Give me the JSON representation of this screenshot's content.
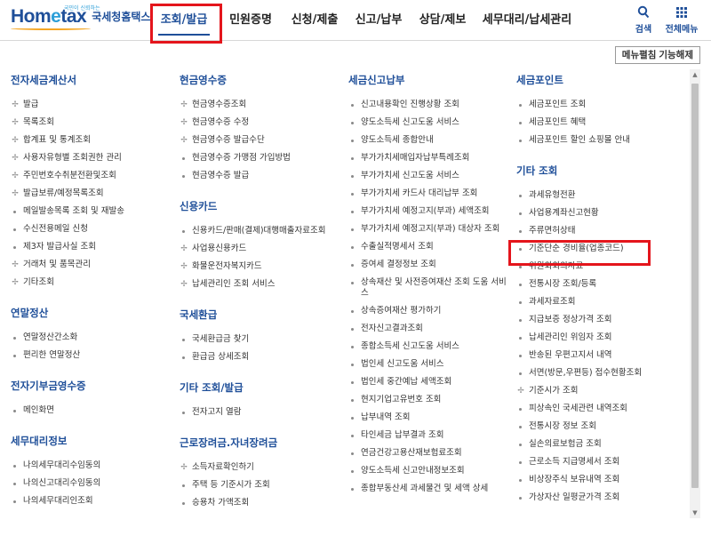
{
  "header": {
    "logo_main_a": "Hom",
    "logo_main_e": "e",
    "logo_main_b": "tax",
    "logo_tag": "국민이 신뢰하는",
    "logo_sub": "국세청홈택스",
    "nav": [
      "조회/발급",
      "민원증명",
      "신청/제출",
      "신고/납부",
      "상담/제보",
      "세무대리/납세관리"
    ],
    "search_label": "검색",
    "menu_label": "전체메뉴"
  },
  "toolbar": {
    "unfold_label": "메뉴펼침 기능해제"
  },
  "columns": [
    {
      "sections": [
        {
          "title": "전자세금계산서",
          "items": [
            {
              "t": "발급",
              "m": "plus"
            },
            {
              "t": "목록조회",
              "m": "plus"
            },
            {
              "t": "합계표 및 통계조회",
              "m": "plus"
            },
            {
              "t": "사용자유형별 조회권한 관리",
              "m": "plus"
            },
            {
              "t": "주민번호수취분전환및조회",
              "m": "plus"
            },
            {
              "t": "발급보류/예정목록조회",
              "m": "plus"
            },
            {
              "t": "메일발송목록 조회 및 재발송",
              "m": "dot"
            },
            {
              "t": "수신전용메일 신청",
              "m": "dot"
            },
            {
              "t": "제3자 발급사실 조회",
              "m": "dot"
            },
            {
              "t": "거래처 및 품목관리",
              "m": "plus"
            },
            {
              "t": "기타조회",
              "m": "plus"
            }
          ]
        },
        {
          "title": "연말정산",
          "items": [
            {
              "t": "연말정산간소화",
              "m": "dot"
            },
            {
              "t": "편리한 연말정산",
              "m": "dot"
            }
          ]
        },
        {
          "title": "전자기부금영수증",
          "items": [
            {
              "t": "메인화면",
              "m": "dot"
            }
          ]
        },
        {
          "title": "세무대리정보",
          "items": [
            {
              "t": "나의세무대리수임동의",
              "m": "dot"
            },
            {
              "t": "나의신고대리수임동의",
              "m": "dot"
            },
            {
              "t": "나의세무대리인조회",
              "m": "dot"
            }
          ]
        }
      ]
    },
    {
      "sections": [
        {
          "title": "현금영수증",
          "items": [
            {
              "t": "현금영수증조회",
              "m": "plus"
            },
            {
              "t": "현금영수증 수정",
              "m": "plus"
            },
            {
              "t": "현금영수증 발급수단",
              "m": "plus"
            },
            {
              "t": "현금영수증 가맹점 가입방법",
              "m": "dot"
            },
            {
              "t": "현금영수증 발급",
              "m": "dot"
            }
          ]
        },
        {
          "title": "신용카드",
          "items": [
            {
              "t": "신용카드/판매(결제)대행매출자료조회",
              "m": "dot"
            },
            {
              "t": "사업용신용카드",
              "m": "plus"
            },
            {
              "t": "화물운전자복지카드",
              "m": "plus"
            },
            {
              "t": "납세관리인 조회 서비스",
              "m": "plus"
            }
          ]
        },
        {
          "title": "국세환급",
          "items": [
            {
              "t": "국세환급금 찾기",
              "m": "dot"
            },
            {
              "t": "환급금 상세조회",
              "m": "dot"
            }
          ]
        },
        {
          "title": "기타 조회/발급",
          "items": [
            {
              "t": "전자고지 열람",
              "m": "dot"
            }
          ]
        },
        {
          "title": "근로장려금.자녀장려금",
          "items": [
            {
              "t": "소득자료확인하기",
              "m": "plus"
            },
            {
              "t": "주택 등 기준시가 조회",
              "m": "dot"
            },
            {
              "t": "승용차 가액조회",
              "m": "dot"
            }
          ]
        }
      ]
    },
    {
      "sections": [
        {
          "title": "세금신고납부",
          "items": [
            {
              "t": "신고내용확인 진행상황 조회",
              "m": "dot"
            },
            {
              "t": "양도소득세 신고도움 서비스",
              "m": "dot"
            },
            {
              "t": "양도소득세 종합안내",
              "m": "dot"
            },
            {
              "t": "부가가치세매입자납부특례조회",
              "m": "dot"
            },
            {
              "t": "부가가치세 신고도움 서비스",
              "m": "dot"
            },
            {
              "t": "부가가치세 카드사 대리납부 조회",
              "m": "dot"
            },
            {
              "t": "부가가치세 예정고지(부과) 세액조회",
              "m": "dot"
            },
            {
              "t": "부가가치세 예정고지(부과) 대상자 조회",
              "m": "dot",
              "wrap": true
            },
            {
              "t": "수출실적명세서 조회",
              "m": "dot"
            },
            {
              "t": "증여세 결정정보 조회",
              "m": "dot"
            },
            {
              "t": "상속재산 및 사전증여재산 조회 도움 서비스",
              "m": "dot",
              "wrap": true
            },
            {
              "t": "상속증여재산 평가하기",
              "m": "dot"
            },
            {
              "t": "전자신고결과조회",
              "m": "dot"
            },
            {
              "t": "종합소득세 신고도움 서비스",
              "m": "dot"
            },
            {
              "t": "법인세 신고도움 서비스",
              "m": "dot"
            },
            {
              "t": "법인세 중간예납 세액조회",
              "m": "dot"
            },
            {
              "t": "현지기업고유번호 조회",
              "m": "dot"
            },
            {
              "t": "납부내역 조회",
              "m": "dot"
            },
            {
              "t": "타인세금 납부결과 조회",
              "m": "dot"
            },
            {
              "t": "연금건강고용산재보험료조회",
              "m": "dot"
            },
            {
              "t": "양도소득세 신고안내정보조회",
              "m": "dot"
            },
            {
              "t": "종합부동산세 과세물건 및 세액 상세",
              "m": "dot"
            }
          ]
        }
      ]
    },
    {
      "sections": [
        {
          "title": "세금포인트",
          "items": [
            {
              "t": "세금포인트 조회",
              "m": "dot"
            },
            {
              "t": "세금포인트 혜택",
              "m": "dot"
            },
            {
              "t": "세금포인트 할인 쇼핑몰 안내",
              "m": "dot"
            }
          ]
        },
        {
          "title": "기타 조회",
          "items": [
            {
              "t": "과세유형전환",
              "m": "dot"
            },
            {
              "t": "사업용계좌신고현황",
              "m": "dot"
            },
            {
              "t": "주류면허상태",
              "m": "dot"
            },
            {
              "t": "기준단순 경비율(업종코드)",
              "m": "dot"
            },
            {
              "t": "위원회회의자료",
              "m": "dot"
            },
            {
              "t": "전통시장 조회/등록",
              "m": "dot"
            },
            {
              "t": "과세자료조회",
              "m": "dot"
            },
            {
              "t": "지급보증 정상가격 조회",
              "m": "dot"
            },
            {
              "t": "납세관리인 위임자 조회",
              "m": "dot"
            },
            {
              "t": "반송된 우편고지서 내역",
              "m": "dot"
            },
            {
              "t": "서면(방문,우편등) 접수현황조회",
              "m": "dot"
            },
            {
              "t": "기준시가 조회",
              "m": "plus"
            },
            {
              "t": "피상속인 국세관련 내역조회",
              "m": "dot"
            },
            {
              "t": "전통시장 정보 조회",
              "m": "dot"
            },
            {
              "t": "실손의료보험금 조회",
              "m": "dot"
            },
            {
              "t": "근로소득 지급명세서 조회",
              "m": "dot"
            },
            {
              "t": "비상장주식 보유내역 조회",
              "m": "dot"
            },
            {
              "t": "가상자산 일평균가격 조회",
              "m": "dot"
            }
          ]
        }
      ]
    }
  ]
}
